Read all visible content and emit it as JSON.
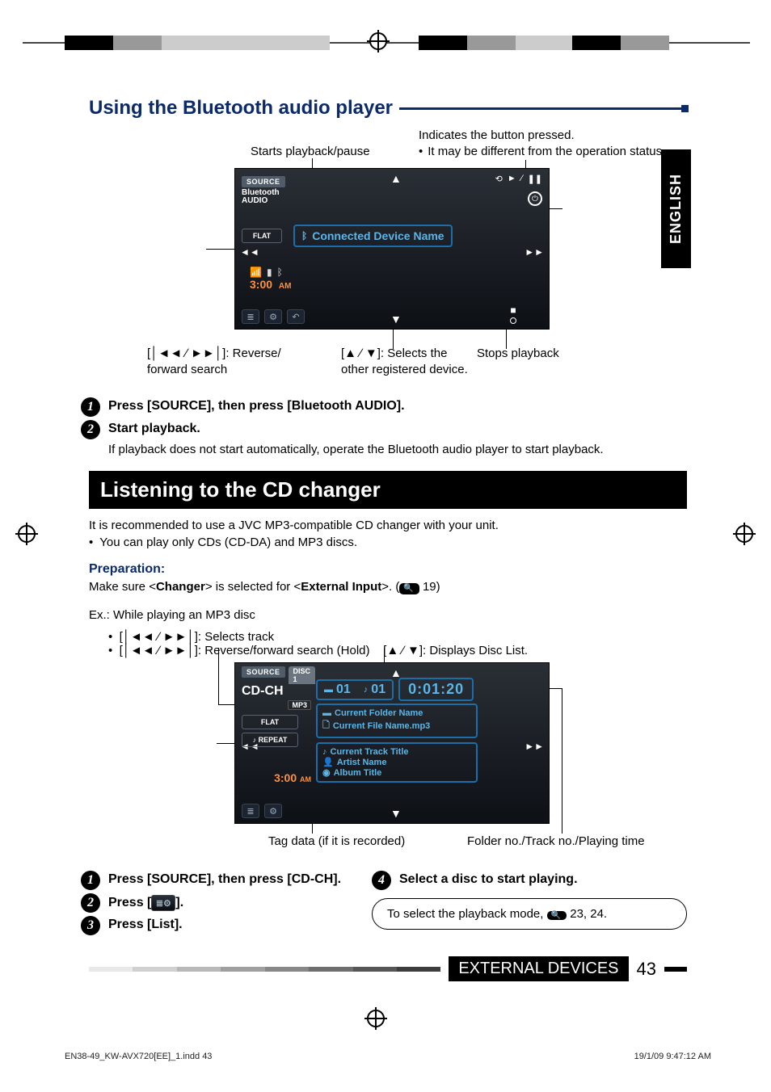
{
  "language_tab": "ENGLISH",
  "section1_title": "Using the Bluetooth audio player",
  "bt_callouts": {
    "starts": "Starts playback/pause",
    "indicates": "Indicates the button pressed.",
    "indicates_sub": "It may be different from the operation status.",
    "rev_fwd_1": "[",
    "rev_fwd_2": "]: Reverse/",
    "rev_fwd_3": "forward search",
    "selects_1": "[",
    "selects_2": "]: Selects the",
    "selects_3": "other registered device.",
    "stops": "Stops playback"
  },
  "bt_screen": {
    "source": "SOURCE",
    "bt_audio_1": "Bluetooth",
    "bt_audio_2": "AUDIO",
    "flat": "FLAT",
    "conn": "Connected Device Name",
    "time": "3:00",
    "ampm": "AM"
  },
  "bt_steps": {
    "s1": "Press [SOURCE], then press [Bluetooth AUDIO].",
    "s2": "Start playback.",
    "s2_sub": "If playback does not start automatically, operate the Bluetooth audio player to start playback."
  },
  "banner": "Listening to the CD changer",
  "cdch_intro": "It is recommended to use a JVC MP3-compatible CD changer with your unit.",
  "cdch_intro_bullet": "You can play only CDs (CD-DA) and MP3 discs.",
  "prep_label": "Preparation:",
  "prep_text_a": "Make sure <",
  "prep_changer": "Changer",
  "prep_text_b": "> is selected for <",
  "prep_ext": "External Input",
  "prep_text_c": ">. (",
  "prep_page": " 19)",
  "ex_line": "Ex.:  While playing an MP3 disc",
  "pre_bullets": {
    "b1a": "[",
    "b1b": "]: Selects track",
    "b2a": "[",
    "b2b": "]: Reverse/forward search (Hold)",
    "b3a": "[",
    "b3b": "]: Displays Disc List."
  },
  "cdch_screen": {
    "source": "SOURCE",
    "disc": "DISC 1",
    "main": "CD-CH",
    "mp3": "MP3",
    "folder_no": "01",
    "track_no": "01",
    "time": "0:01:20",
    "flat": "FLAT",
    "repeat": "REPEAT",
    "folder_name": "Current Folder Name",
    "file_name": "Current File Name.mp3",
    "track_title": "Current Track Title",
    "artist": "Artist Name",
    "album": "Album Title",
    "clock": "3:00",
    "ampm": "AM"
  },
  "cdch_callouts": {
    "tag": "Tag data (if it is recorded)",
    "folder_track_time": "Folder no./Track no./Playing time"
  },
  "cdch_steps": {
    "s1": "Press [SOURCE], then press [CD-CH].",
    "s2a": "Press [",
    "s2b": "].",
    "s3": "Press [List].",
    "s4": "Select a disc to start playing."
  },
  "note_a": "To select the playback mode, ",
  "note_b": " 23, 24.",
  "footer_label": "EXTERNAL DEVICES",
  "page_number": "43",
  "footer_file": "EN38-49_KW-AVX720[EE]_1.indd   43",
  "footer_date": "19/1/09   9:47:12 AM"
}
